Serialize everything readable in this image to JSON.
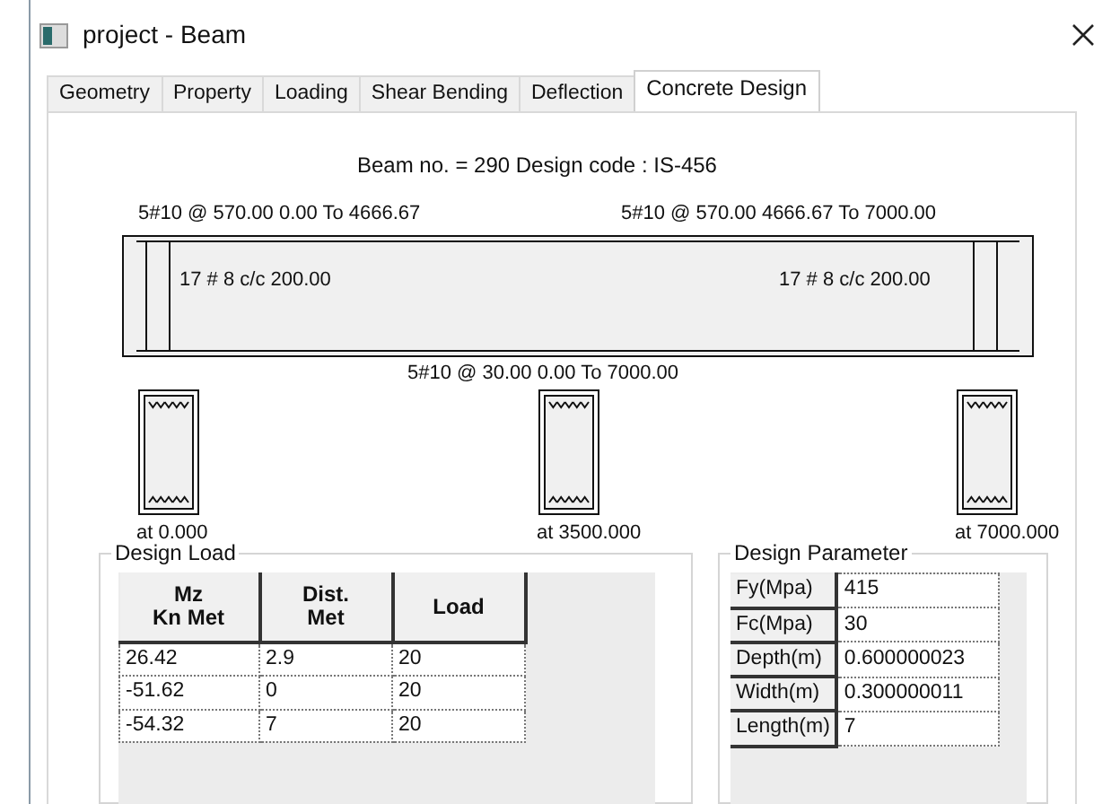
{
  "window": {
    "title": "project - Beam"
  },
  "tabs": [
    {
      "label": "Geometry",
      "selected": false
    },
    {
      "label": "Property",
      "selected": false
    },
    {
      "label": "Loading",
      "selected": false
    },
    {
      "label": "Shear Bending",
      "selected": false
    },
    {
      "label": "Deflection",
      "selected": false
    },
    {
      "label": "Concrete Design",
      "selected": true
    }
  ],
  "beam": {
    "heading": "Beam no. = 290  Design code :  IS-456",
    "top_bars": [
      "5#10 @ 570.00 0.00 To 4666.67",
      "5#10 @ 570.00 4666.67 To 7000.00"
    ],
    "stirrups": [
      "17 # 8 c/c 200.00",
      "17 # 8 c/c 200.00"
    ],
    "bottom_bar": "5#10 @ 30.00 0.00 To 7000.00",
    "sections": [
      {
        "label": "at 0.000"
      },
      {
        "label": "at 3500.000"
      },
      {
        "label": "at 7000.000"
      }
    ]
  },
  "design_load": {
    "title": "Design Load",
    "columns": [
      "Mz\nKn Met",
      "Dist.\nMet",
      "Load"
    ],
    "rows": [
      [
        "26.42",
        "2.9",
        "20"
      ],
      [
        "-51.62",
        "0",
        "20"
      ],
      [
        "-54.32",
        "7",
        "20"
      ]
    ]
  },
  "design_parameter": {
    "title": "Design Parameter",
    "rows": [
      {
        "label": "Fy(Mpa)",
        "value": "415"
      },
      {
        "label": "Fc(Mpa)",
        "value": "30"
      },
      {
        "label": "Depth(m)",
        "value": "0.600000023"
      },
      {
        "label": "Width(m)",
        "value": "0.300000011"
      },
      {
        "label": "Length(m)",
        "value": "7"
      }
    ]
  }
}
